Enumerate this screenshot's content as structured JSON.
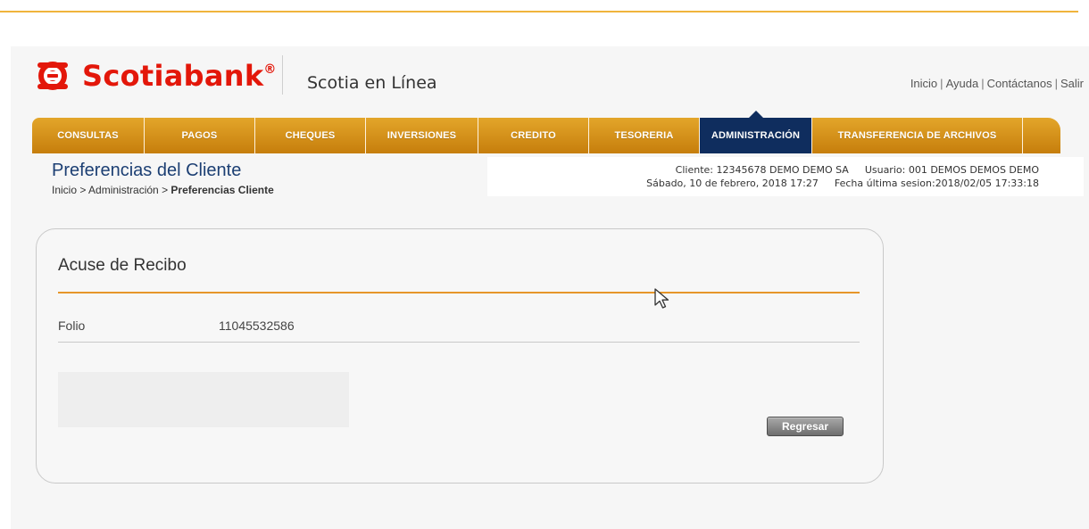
{
  "header": {
    "brand": "Scotiabank",
    "brand_mark": "®",
    "app_name": "Scotia en Línea",
    "links": [
      "Inicio",
      "Ayuda",
      "Contáctanos",
      "Salir"
    ],
    "brand_color": "#e3170a"
  },
  "nav": {
    "items": [
      {
        "label": "CONSULTAS",
        "active": false
      },
      {
        "label": "PAGOS",
        "active": false
      },
      {
        "label": "CHEQUES",
        "active": false
      },
      {
        "label": "INVERSIONES",
        "active": false
      },
      {
        "label": "CREDITO",
        "active": false
      },
      {
        "label": "TESORERIA",
        "active": false
      },
      {
        "label": "ADMINISTRACIÓN",
        "active": true
      },
      {
        "label": "TRANSFERENCIA DE ARCHIVOS",
        "active": false
      }
    ],
    "accent_color": "#d9961e",
    "active_color": "#0f2d5e"
  },
  "page": {
    "title": "Preferencias del Cliente",
    "breadcrumb": {
      "inicio": "Inicio",
      "sep1": " > ",
      "section": "Administración",
      "sep2": " > ",
      "current": "Preferencias Cliente"
    }
  },
  "client_info": {
    "cliente_label": "Cliente:",
    "cliente_value": "12345678 DEMO DEMO SA",
    "usuario_label": "Usuario:",
    "usuario_value": "001 DEMOS DEMOS DEMO",
    "date": "Sábado, 10 de febrero, 2018 17:27",
    "last_session_label": "Fecha última sesion:",
    "last_session_value": "2018/02/05 17:33:18"
  },
  "receipt": {
    "title": "Acuse de Recibo",
    "folio_label": "Folio",
    "folio_value": "11045532586",
    "back_button": "Regresar"
  },
  "icons": {
    "logo": "scotiabank-logo-icon",
    "cursor": "mouse-pointer-icon"
  }
}
